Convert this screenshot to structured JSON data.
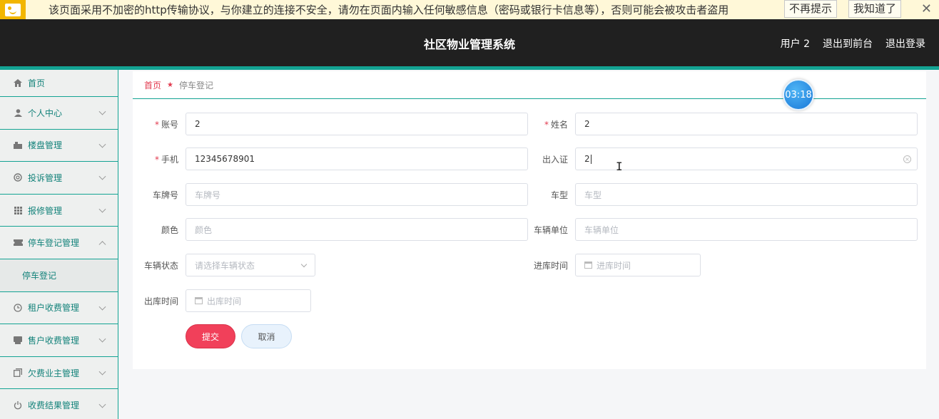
{
  "banner": {
    "text": "该页面采用不加密的http传输协议，与你建立的连接不安全，请勿在页面内输入任何敏感信息（密码或银行卡信息等），否则可能会被攻击者盗用",
    "dismiss_label": "不再提示",
    "ok_label": "我知道了",
    "close_glyph": "✕"
  },
  "header": {
    "title": "社区物业管理系统",
    "user_label": "用户 2",
    "frontend_label": "退出到前台",
    "logout_label": "退出登录"
  },
  "sidebar": {
    "items": [
      {
        "label": "首页",
        "icon": "home-icon"
      },
      {
        "label": "个人中心",
        "icon": "user-icon"
      },
      {
        "label": "楼盘管理",
        "icon": "building-icon"
      },
      {
        "label": "投诉管理",
        "icon": "complaint-icon"
      },
      {
        "label": "报修管理",
        "icon": "grid-icon"
      },
      {
        "label": "停车登记管理",
        "icon": "ticket-icon"
      },
      {
        "label": "停车登记",
        "icon": ""
      },
      {
        "label": "租户收费管理",
        "icon": "clock-icon"
      },
      {
        "label": "售户收费管理",
        "icon": "printer-icon"
      },
      {
        "label": "欠费业主管理",
        "icon": "copy-icon"
      },
      {
        "label": "收费结果管理",
        "icon": "power-icon"
      }
    ]
  },
  "breadcrumb": {
    "home": "首页",
    "current": "停车登记"
  },
  "form": {
    "account_label": "账号",
    "account_value": "2",
    "name_label": "姓名",
    "name_value": "2",
    "phone_label": "手机",
    "phone_value": "12345678901",
    "pass_label": "出入证",
    "pass_value": "2",
    "plate_label": "车牌号",
    "plate_placeholder": "车牌号",
    "type_label": "车型",
    "type_placeholder": "车型",
    "color_label": "颜色",
    "color_placeholder": "颜色",
    "unit_label": "车辆单位",
    "unit_placeholder": "车辆单位",
    "status_label": "车辆状态",
    "status_placeholder": "请选择车辆状态",
    "in_time_label": "进库时间",
    "in_time_placeholder": "进库时间",
    "out_time_label": "出库时间",
    "out_time_placeholder": "出库时间",
    "submit_label": "提交",
    "cancel_label": "取消"
  },
  "timer": {
    "value": "03:18"
  },
  "colors": {
    "accent": "#13a393",
    "danger": "#f1405a",
    "header_bg": "#202020"
  }
}
